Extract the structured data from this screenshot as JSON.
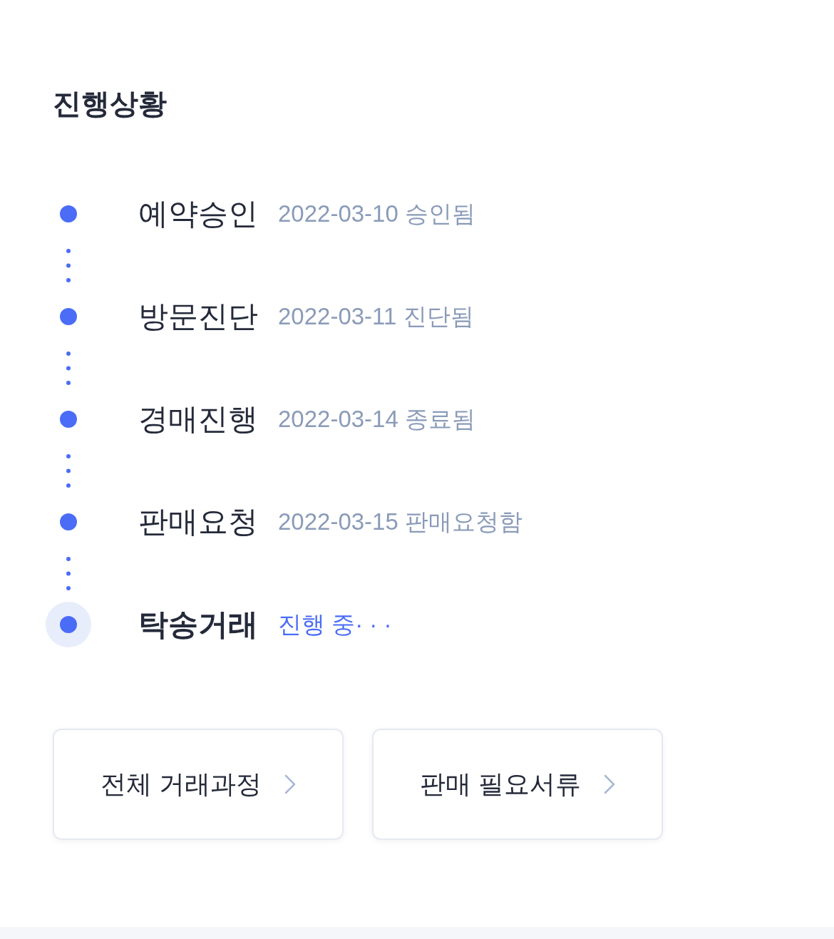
{
  "section": {
    "title": "진행상황"
  },
  "steps": [
    {
      "label": "예약승인",
      "note": "2022-03-10 승인됨",
      "current": false
    },
    {
      "label": "방문진단",
      "note": "2022-03-11 진단됨",
      "current": false
    },
    {
      "label": "경매진행",
      "note": "2022-03-14 종료됨",
      "current": false
    },
    {
      "label": "판매요청",
      "note": "2022-03-15 판매요청함",
      "current": false
    },
    {
      "label": "탁송거래",
      "note": "진행 중· · ·",
      "current": true
    }
  ],
  "buttons": [
    {
      "label": "전체 거래과정"
    },
    {
      "label": "판매 필요서류"
    }
  ]
}
